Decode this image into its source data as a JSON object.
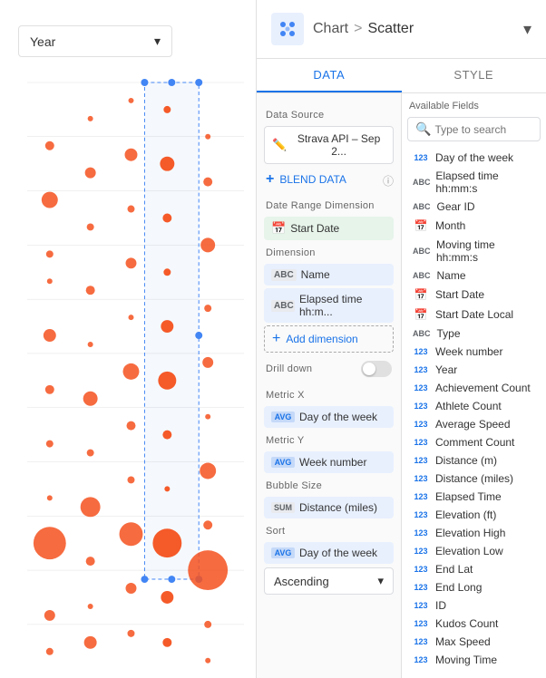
{
  "header": {
    "title": "Chart",
    "separator": ">",
    "subtitle": "Scatter",
    "chevron": "▾"
  },
  "tabs": [
    {
      "label": "DATA",
      "active": true
    },
    {
      "label": "STYLE",
      "active": false
    }
  ],
  "left_panel": {
    "year_selector": "Year"
  },
  "data_panel": {
    "data_source_label": "Data Source",
    "data_source_name": "Strava API – Sep 2...",
    "blend_label": "BLEND DATA",
    "date_range_label": "Date Range Dimension",
    "date_range_value": "Start Date",
    "dimension_label": "Dimension",
    "dimension_1": "Name",
    "dimension_2": "Elapsed time hh:m...",
    "add_dimension": "Add dimension",
    "drill_down_label": "Drill down",
    "metric_x_label": "Metric X",
    "metric_x_value": "Day of the week",
    "metric_y_label": "Metric Y",
    "metric_y_value": "Week number",
    "bubble_size_label": "Bubble Size",
    "bubble_size_value": "Distance (miles)",
    "sort_label": "Sort",
    "sort_value": "Day of the week",
    "ascending_label": "Ascending",
    "chip_avg": "AVG",
    "chip_sum": "SUM",
    "chip_abc": "ABC"
  },
  "available_fields": {
    "label": "Available Fields",
    "search_placeholder": "Type to search",
    "fields": [
      {
        "type": "123",
        "name": "Day of the week"
      },
      {
        "type": "ABC",
        "name": "Elapsed time hh:mm:s"
      },
      {
        "type": "ABC",
        "name": "Gear ID"
      },
      {
        "type": "CAL",
        "name": "Month"
      },
      {
        "type": "ABC",
        "name": "Moving time hh:mm:s"
      },
      {
        "type": "ABC",
        "name": "Name"
      },
      {
        "type": "CAL",
        "name": "Start Date"
      },
      {
        "type": "CAL",
        "name": "Start Date Local"
      },
      {
        "type": "ABC",
        "name": "Type"
      },
      {
        "type": "123",
        "name": "Week number"
      },
      {
        "type": "123",
        "name": "Year"
      },
      {
        "type": "123",
        "name": "Achievement Count"
      },
      {
        "type": "123",
        "name": "Athlete Count"
      },
      {
        "type": "123",
        "name": "Average Speed"
      },
      {
        "type": "123",
        "name": "Comment Count"
      },
      {
        "type": "123",
        "name": "Distance (m)"
      },
      {
        "type": "123",
        "name": "Distance (miles)"
      },
      {
        "type": "123",
        "name": "Elapsed Time"
      },
      {
        "type": "123",
        "name": "Elevation (ft)"
      },
      {
        "type": "123",
        "name": "Elevation High"
      },
      {
        "type": "123",
        "name": "Elevation Low"
      },
      {
        "type": "123",
        "name": "End Lat"
      },
      {
        "type": "123",
        "name": "End Long"
      },
      {
        "type": "123",
        "name": "ID"
      },
      {
        "type": "123",
        "name": "Kudos Count"
      },
      {
        "type": "123",
        "name": "Max Speed"
      },
      {
        "type": "123",
        "name": "Moving Time"
      }
    ]
  }
}
